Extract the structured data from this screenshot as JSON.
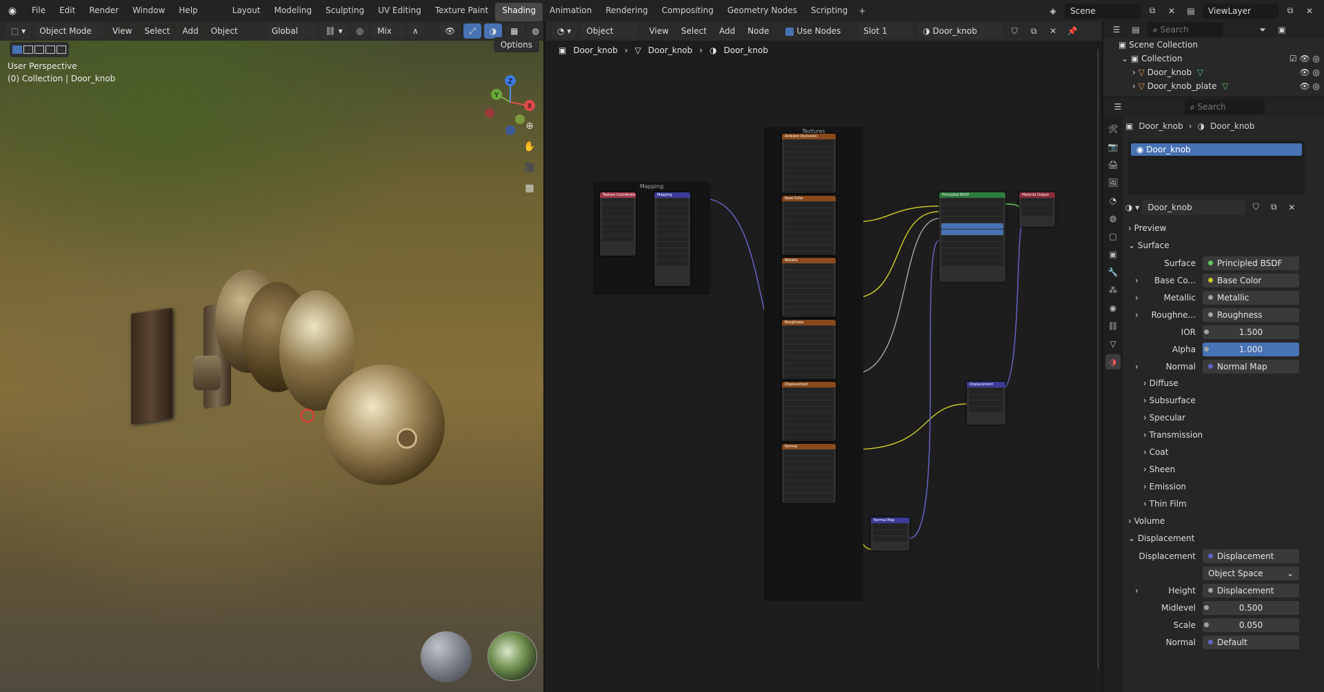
{
  "colors": {
    "accent": "#4772b3",
    "socket_shader": "#63c763",
    "socket_color": "#c7c729",
    "socket_float": "#a1a1a1",
    "socket_vector": "#6363c7",
    "link_yellow": "#c7c729",
    "link_purple": "#6363c7"
  },
  "menu": {
    "items": [
      "File",
      "Edit",
      "Render",
      "Window",
      "Help"
    ]
  },
  "workspaces": {
    "items": [
      "Layout",
      "Modeling",
      "Sculpting",
      "UV Editing",
      "Texture Paint",
      "Shading",
      "Animation",
      "Rendering",
      "Compositing",
      "Geometry Nodes",
      "Scripting"
    ],
    "active": "Shading"
  },
  "topright": {
    "scene": "Scene",
    "view_layer": "ViewLayer"
  },
  "viewport": {
    "mode": "Object Mode",
    "menu": [
      "View",
      "Select",
      "Add",
      "Object"
    ],
    "orientation": "Global",
    "shading_mix": "Mix",
    "perspective": "User Perspective",
    "collection_info": "(0) Collection | Door_knob",
    "options": "Options",
    "gizmo": {
      "x": "X",
      "y": "Y",
      "z": "Z"
    }
  },
  "node_editor": {
    "type": "Object",
    "menu": [
      "View",
      "Select",
      "Add",
      "Node"
    ],
    "use_nodes": "Use Nodes",
    "slot": "Slot 1",
    "material": "Door_knob",
    "breadcrumb": [
      "Door_knob",
      "Door_knob",
      "Door_knob"
    ],
    "frames": {
      "mapping": "Mapping",
      "textures": "Textures"
    },
    "nodes": {
      "texcoord": "Texture Coordinate",
      "mapping": "Mapping",
      "tex": [
        "Ambient Occlusion",
        "Base Color",
        "Metallic",
        "Roughness",
        "Displacement",
        "Normal"
      ],
      "bsdf": "Principled BSDF",
      "output": "Material Output",
      "disp": "Displacement",
      "normalmap": "Normal Map"
    }
  },
  "outliner": {
    "search": "Search",
    "root": "Scene Collection",
    "collection": "Collection",
    "objects": [
      "Door_knob",
      "Door_knob_plate"
    ]
  },
  "properties": {
    "search": "Search",
    "breadcrumb": [
      "Door_knob",
      "Door_knob"
    ],
    "slot_item": "Door_knob",
    "material_name": "Door_knob",
    "preview": "Preview",
    "surface_header": "Surface",
    "rows": [
      {
        "label": "Surface",
        "value": "Principled BSDF",
        "socket": "#63c763"
      },
      {
        "label": "Base Co...",
        "value": "Base Color",
        "socket": "#c7c729",
        "expand": true
      },
      {
        "label": "Metallic",
        "value": "Metallic",
        "socket": "#a1a1a1",
        "expand": true
      },
      {
        "label": "Roughne...",
        "value": "Roughness",
        "socket": "#a1a1a1",
        "expand": true
      },
      {
        "label": "IOR",
        "value": "1.500",
        "num": true
      },
      {
        "label": "Alpha",
        "value": "1.000",
        "num": true,
        "blue": true
      },
      {
        "label": "Normal",
        "value": "Normal Map",
        "socket": "#6363c7",
        "expand": true
      }
    ],
    "subsections": [
      "Diffuse",
      "Subsurface",
      "Specular",
      "Transmission",
      "Coat",
      "Sheen",
      "Emission",
      "Thin Film"
    ],
    "volume": "Volume",
    "displacement_header": "Displacement",
    "disp_rows": [
      {
        "label": "Displacement",
        "value": "Displacement",
        "socket": "#6363c7"
      },
      {
        "label": "",
        "value": "Object Space",
        "dropdown": true
      },
      {
        "label": "Height",
        "value": "Displacement",
        "socket": "#a1a1a1",
        "expand": true
      },
      {
        "label": "Midlevel",
        "value": "0.500",
        "num": true
      },
      {
        "label": "Scale",
        "value": "0.050",
        "num": true
      },
      {
        "label": "Normal",
        "value": "Default",
        "socket": "#6363c7"
      }
    ]
  }
}
